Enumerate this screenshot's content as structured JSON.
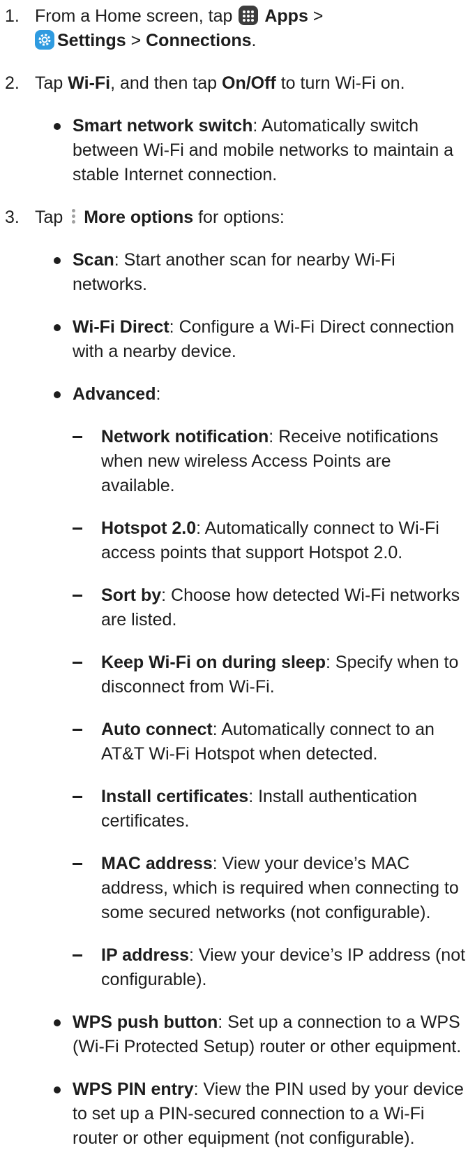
{
  "step1": {
    "num": "1.",
    "pre": "From a Home screen, tap ",
    "apps": "Apps",
    "sep1": " >",
    "settings": "Settings",
    "sep2": " > ",
    "connections": "Connections",
    "end": "."
  },
  "step2": {
    "num": "2.",
    "pre": "Tap ",
    "wifi": "Wi-Fi",
    "mid": ", and then tap ",
    "onoff": "On/Off",
    "end": " to turn Wi-Fi on."
  },
  "smart_switch": {
    "term": "Smart network switch",
    "desc": ": Automatically switch between Wi-Fi and mobile networks to maintain a stable Internet connection."
  },
  "step3": {
    "num": "3.",
    "pre": "Tap ",
    "more": "More options",
    "end": " for options:"
  },
  "options": [
    {
      "term": "Scan",
      "desc": ": Start another scan for nearby Wi-Fi networks."
    },
    {
      "term": "Wi-Fi Direct",
      "desc": ": Configure a Wi-Fi Direct connection with a nearby device."
    },
    {
      "term": "Advanced",
      "desc": ":"
    }
  ],
  "advanced": [
    {
      "term": "Network notification",
      "desc": ": Receive notifications when new wireless Access Points are available."
    },
    {
      "term": "Hotspot 2.0",
      "desc": ": Automatically connect to Wi-Fi access points that support Hotspot 2.0."
    },
    {
      "term": "Sort by",
      "desc": ": Choose how detected Wi-Fi networks are listed."
    },
    {
      "term": "Keep Wi-Fi on during sleep",
      "desc": ": Specify when to disconnect from Wi-Fi."
    },
    {
      "term": "Auto connect",
      "desc": ": Automatically connect to an AT&T Wi-Fi Hotspot when detected."
    },
    {
      "term": "Install certificates",
      "desc": ": Install authentication certificates."
    },
    {
      "term": "MAC address",
      "desc": ": View your device’s MAC address, which is required when connecting to some secured networks (not configurable)."
    },
    {
      "term": "IP address",
      "desc": ": View your device’s IP address (not configurable)."
    }
  ],
  "more_options": [
    {
      "term": "WPS push button",
      "desc": ": Set up a connection to a WPS (Wi-Fi Protected Setup) router or other equipment."
    },
    {
      "term": "WPS PIN entry",
      "desc": ": View the PIN used by your device to set up a PIN-secured connection to a Wi-Fi router or other equipment (not configurable)."
    }
  ],
  "icons": {
    "apps": "apps-grid-icon",
    "settings": "settings-gear-icon",
    "more": "more-options-icon"
  },
  "colors": {
    "text": "#1d1d1d",
    "settings_icon": "#2f9be0",
    "apps_icon": "#3d3d3d"
  }
}
